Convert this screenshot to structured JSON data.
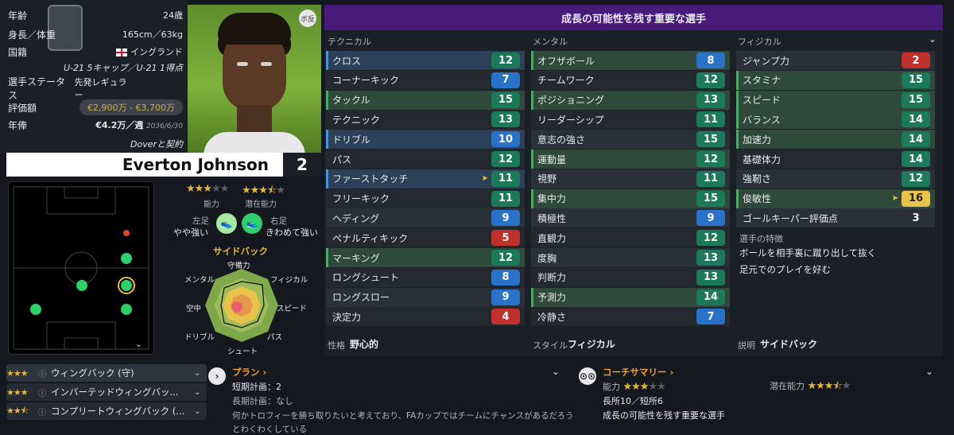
{
  "player": {
    "age_label": "年齢",
    "age_value": "24歳",
    "height_label": "身長／体重",
    "height_value": "165cm／63kg",
    "nationality_label": "国籍",
    "nationality_value": "イングランド",
    "caps": "U-21 5キャップ／U-21 1得点",
    "status_label": "選手ステータス",
    "status_value": "先発レギュラー",
    "value_label": "評価額",
    "value_range": "€2,900万 - €3,700万",
    "wage_label": "年俸",
    "wage_value": "€4.2万／週",
    "contract_end": "2036/6/30",
    "contract_note": "Doverと契約",
    "portrait_badge": "ボ反",
    "name": "Everton Johnson",
    "number": "2"
  },
  "mid": {
    "ability_label": "能力",
    "potential_label": "潜在能力",
    "ability_stars": 3,
    "potential_stars": 3.5,
    "left_foot_label": "左足",
    "left_foot_value": "やや強い",
    "right_foot_label": "右足",
    "right_foot_value": "きわめて強い",
    "position_label": "サイドバック",
    "radar_labels": {
      "top": "守備力",
      "top_right": "フィジカル",
      "right": "スピード",
      "bottom_right": "パス",
      "bottom": "シュート",
      "bottom_left": "ドリブル",
      "left": "空中",
      "top_left": "メンタル"
    }
  },
  "attributes": {
    "title": "成長の可能性を残す重要な選手",
    "technical_head": "テクニカル",
    "mental_head": "メンタル",
    "physical_head": "フィジカル",
    "technical": [
      {
        "label": "クロス",
        "value": "12"
      },
      {
        "label": "コーナーキック",
        "value": "7"
      },
      {
        "label": "タックル",
        "value": "15"
      },
      {
        "label": "テクニック",
        "value": "13"
      },
      {
        "label": "ドリブル",
        "value": "10"
      },
      {
        "label": "パス",
        "value": "12"
      },
      {
        "label": "ファーストタッチ",
        "value": "11"
      },
      {
        "label": "フリーキック",
        "value": "11"
      },
      {
        "label": "ヘディング",
        "value": "9"
      },
      {
        "label": "ペナルティキック",
        "value": "5"
      },
      {
        "label": "マーキング",
        "value": "12"
      },
      {
        "label": "ロングシュート",
        "value": "8"
      },
      {
        "label": "ロングスロー",
        "value": "9"
      },
      {
        "label": "決定力",
        "value": "4"
      }
    ],
    "mental": [
      {
        "label": "オフザボール",
        "value": "8"
      },
      {
        "label": "チームワーク",
        "value": "12"
      },
      {
        "label": "ポジショニング",
        "value": "13"
      },
      {
        "label": "リーダーシップ",
        "value": "11"
      },
      {
        "label": "意志の強さ",
        "value": "15"
      },
      {
        "label": "運動量",
        "value": "12"
      },
      {
        "label": "視野",
        "value": "11"
      },
      {
        "label": "集中力",
        "value": "15"
      },
      {
        "label": "積極性",
        "value": "9"
      },
      {
        "label": "直観力",
        "value": "12"
      },
      {
        "label": "度胸",
        "value": "13"
      },
      {
        "label": "判断力",
        "value": "13"
      },
      {
        "label": "予測力",
        "value": "14"
      },
      {
        "label": "冷静さ",
        "value": "7"
      }
    ],
    "physical": [
      {
        "label": "ジャンプ力",
        "value": "2"
      },
      {
        "label": "スタミナ",
        "value": "15"
      },
      {
        "label": "スピード",
        "value": "15"
      },
      {
        "label": "バランス",
        "value": "14"
      },
      {
        "label": "加速力",
        "value": "14"
      },
      {
        "label": "基礎体力",
        "value": "14"
      },
      {
        "label": "強靭さ",
        "value": "12"
      },
      {
        "label": "俊敏性",
        "value": "16"
      },
      {
        "label": "ゴールキーパー評価点",
        "value": "3"
      }
    ],
    "traits_head": "選手の特徴",
    "traits": [
      "ボールを相手裏に蹴り出して抜く",
      "足元でのプレイを好む"
    ],
    "personality_label": "性格",
    "personality_value": "野心的",
    "style_label": "スタイル",
    "style_value": "フィジカル",
    "description_label": "説明",
    "description_value": "サイドバック"
  },
  "roles": [
    {
      "label": "ウィングバック (守)",
      "stars": 3
    },
    {
      "label": "インバーテッドウィングバッ...",
      "stars": 3
    },
    {
      "label": "コンプリートウィングバック (...",
      "stars": 2.5
    }
  ],
  "plan": {
    "title": "プラン",
    "short_term": "短期計画：2",
    "long_term": "長期計画：なし",
    "desc1": "何かトロフィーを勝ち取りたいと考えており、FAカップではチームにチャンスがあるだろう",
    "desc2": "とわくわくしている"
  },
  "coach": {
    "title": "コーチサマリー",
    "ability_label": "能力",
    "ability_stars": 3,
    "potential_label": "潜在能力",
    "potential_stars": 3.5,
    "strengths": "長所10／短所6",
    "summary": "成長の可能性を残す重要な選手"
  },
  "icons": [
    "chevron-down-icon",
    "info-icon",
    "chevron-right-icon",
    "glasses-icon",
    "boot-icon",
    "flag-england-icon"
  ]
}
